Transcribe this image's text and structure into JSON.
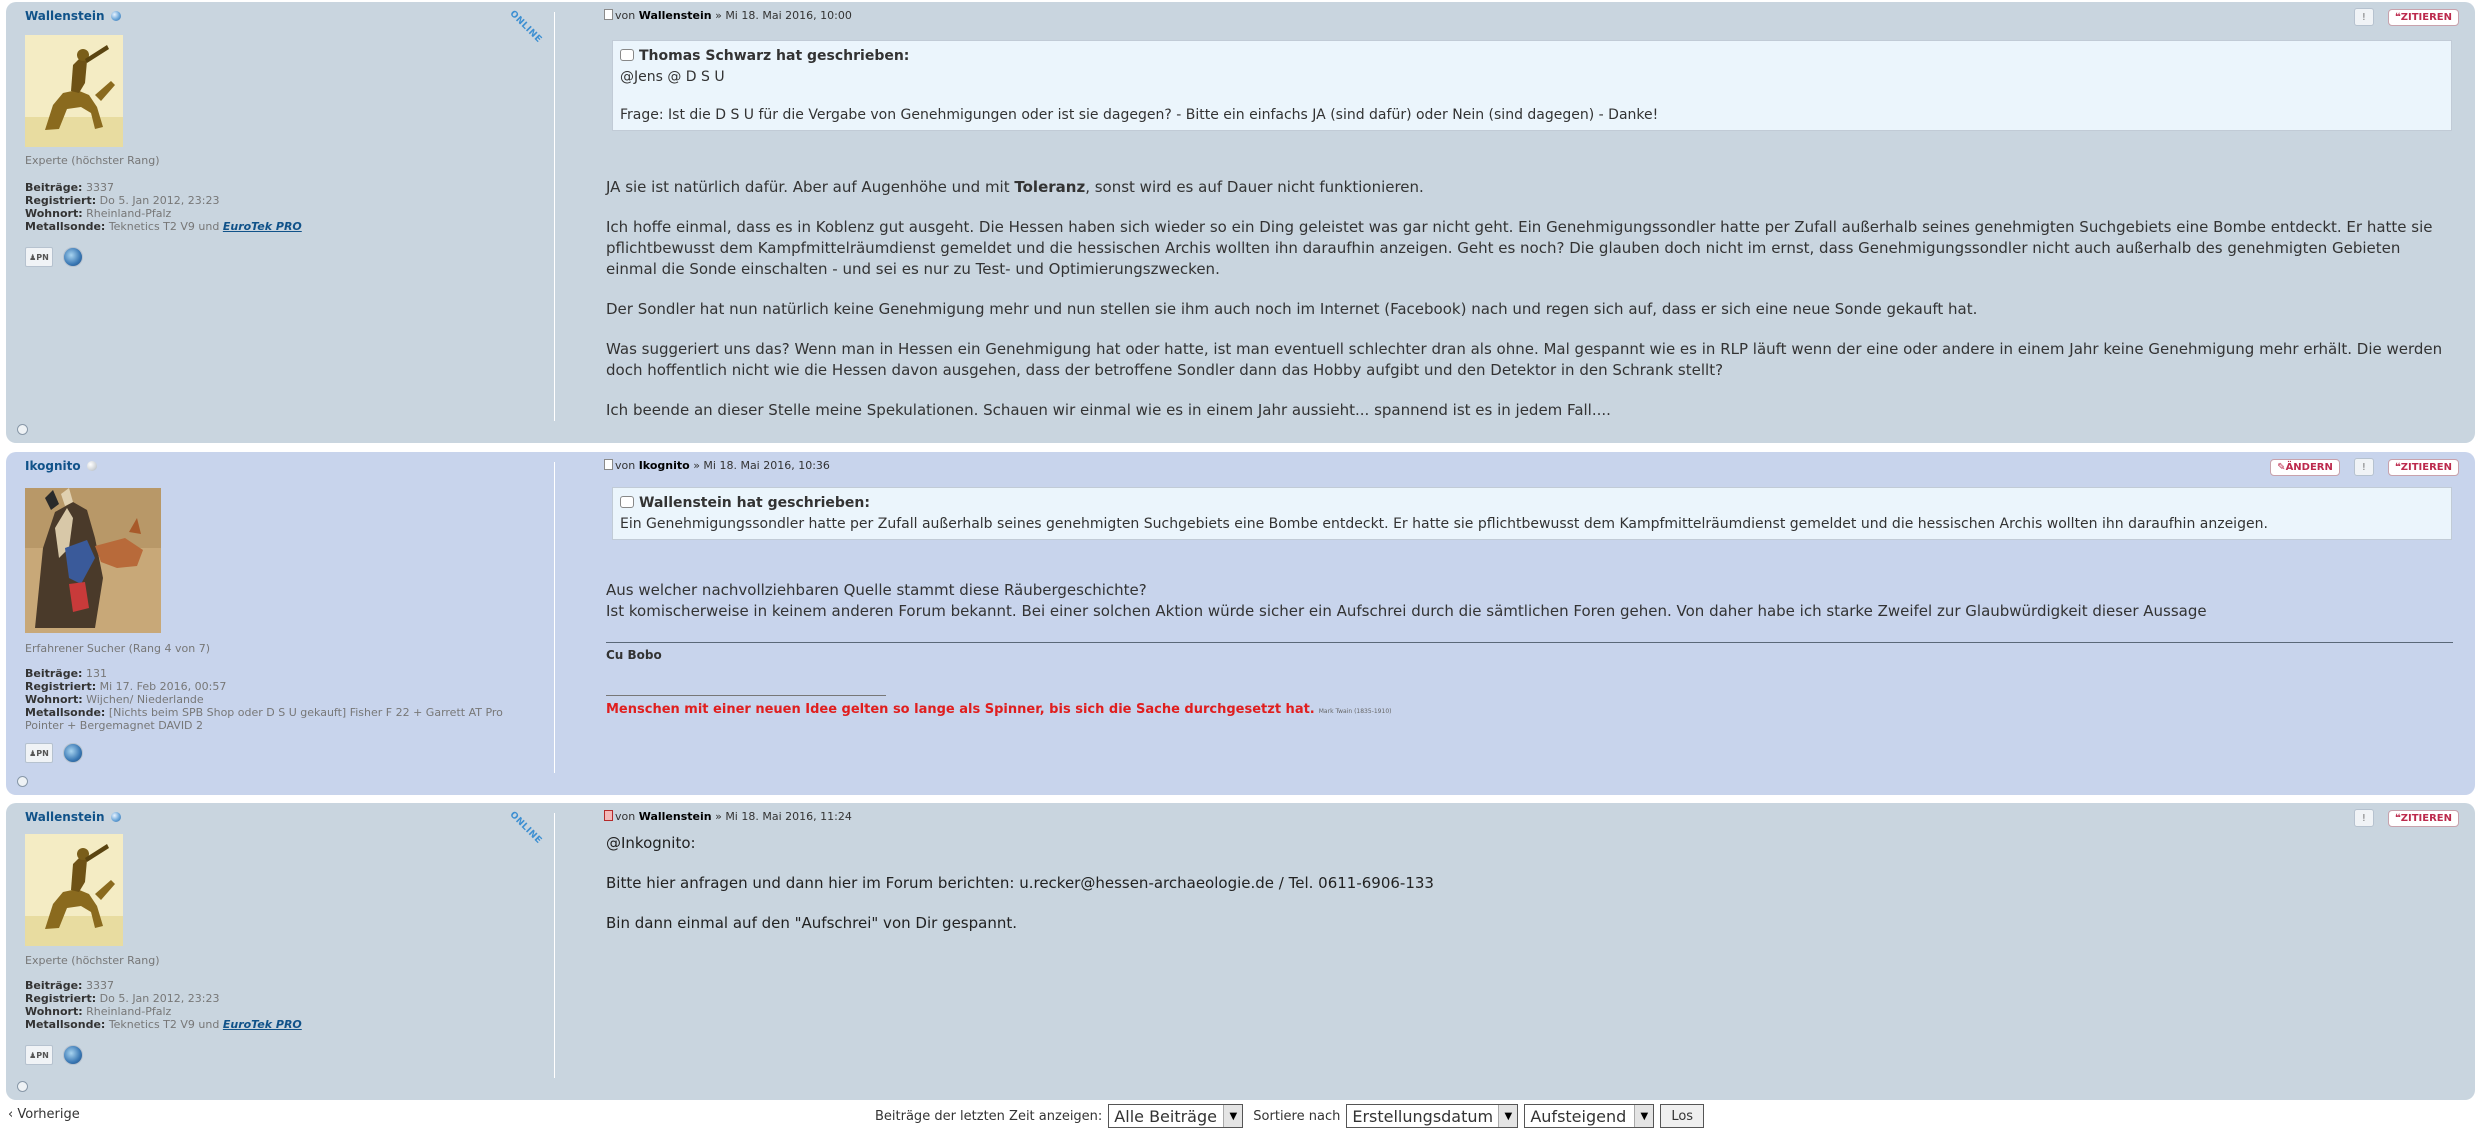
{
  "posts": [
    {
      "username": "Wallenstein",
      "online_badge": "ONLINE",
      "rank": "Experte (höchster Rang)",
      "posts_label": "Beiträge:",
      "posts_value": "3337",
      "registered_label": "Registriert:",
      "registered_value": "Do 5. Jan 2012, 23:23",
      "location_label": "Wohnort:",
      "location_value": "Rheinland-Pfalz",
      "detector_label": "Metallsonde:",
      "detector_value": "Teknetics T2 V9 und",
      "detector_link": "EuroTek PRO",
      "pm_label": "PN",
      "author_prefix": "von",
      "author": "Wallenstein",
      "date": "» Mi 18. Mai 2016, 10:00",
      "quote_button": "ZITIEREN",
      "quote": {
        "header": "Thomas Schwarz hat geschrieben:",
        "lines": [
          "@Jens @ D S U",
          "",
          "Frage: Ist die D S U für die Vergabe von Genehmigungen oder ist sie dagegen? - Bitte ein einfachs JA (sind dafür) oder Nein (sind dagegen) - Danke!"
        ]
      },
      "body_1_before": "JA sie ist natürlich dafür. Aber auf Augenhöhe und mit ",
      "body_1_bold": "Toleranz",
      "body_1_after": ", sonst wird es auf Dauer nicht funktionieren.",
      "body_2": "Ich hoffe einmal, dass es in Koblenz gut ausgeht. Die Hessen haben sich wieder so ein Ding geleistet was gar nicht geht. Ein Genehmigungssondler hatte per Zufall außerhalb seines genehmigten Suchgebiets eine Bombe entdeckt. Er hatte sie pflichtbewusst dem Kampfmittelräumdienst gemeldet und die hessischen Archis wollten ihn daraufhin anzeigen. Geht es noch? Die glauben doch nicht im ernst, dass Genehmigungssondler nicht auch außerhalb des genehmigten Gebieten einmal die Sonde einschalten - und sei es nur zu Test- und Optimierungszwecken.",
      "body_3": "Der Sondler hat nun natürlich keine Genehmigung mehr und nun stellen sie ihm auch noch im Internet (Facebook) nach und regen sich auf, dass er sich eine neue Sonde gekauft hat.",
      "body_4": "Was suggeriert uns das? Wenn man in Hessen ein Genehmigung hat oder hatte, ist man eventuell schlechter dran als ohne. Mal gespannt wie es in RLP läuft wenn der eine oder andere in einem Jahr keine Genehmigung mehr erhält. Die werden doch hoffentlich nicht wie die Hessen davon ausgehen, dass der betroffene Sondler dann das Hobby aufgibt und den Detektor in den Schrank stellt?",
      "body_5": "Ich beende an dieser Stelle meine Spekulationen. Schauen wir einmal wie es in einem Jahr aussieht... spannend ist es in jedem Fall...."
    },
    {
      "username": "Ikognito",
      "rank": "Erfahrener Sucher (Rang 4 von 7)",
      "posts_label": "Beiträge:",
      "posts_value": "131",
      "registered_label": "Registriert:",
      "registered_value": "Mi 17. Feb 2016, 00:57",
      "location_label": "Wohnort:",
      "location_value": "Wijchen/ Niederlande",
      "detector_label": "Metallsonde:",
      "detector_value": "[Nichts beim SPB Shop oder D S U gekauft] Fisher F 22 + Garrett AT Pro Pointer + Bergemagnet DAVID 2",
      "pm_label": "PN",
      "author_prefix": "von",
      "author": "Ikognito",
      "date": "» Mi 18. Mai 2016, 10:36",
      "edit_button": "ÄNDERN",
      "quote_button": "ZITIEREN",
      "quote": {
        "header": "Wallenstein hat geschrieben:",
        "lines": [
          "Ein Genehmigungssondler hatte per Zufall außerhalb seines genehmigten Suchgebiets eine Bombe entdeckt. Er hatte sie pflichtbewusst dem Kampfmittelräumdienst gemeldet und die hessischen Archis wollten ihn daraufhin anzeigen."
        ]
      },
      "body_1": "Aus welcher nachvollziehbaren Quelle stammt diese Räubergeschichte?",
      "body_2": "Ist komischerweise in keinem anderen Forum bekannt. Bei einer solchen Aktion würde sicher ein Aufschrei durch die sämtlichen Foren gehen. Von daher habe ich starke Zweifel zur Glaubwürdigkeit dieser Aussage",
      "signature_name": "Cu Bobo",
      "signature_quote": "Menschen mit einer neuen Idee gelten so lange als Spinner, bis sich die Sache durchgesetzt hat.",
      "signature_small": "Mark Twain (1835-1910)"
    },
    {
      "username": "Wallenstein",
      "online_badge": "ONLINE",
      "rank": "Experte (höchster Rang)",
      "posts_label": "Beiträge:",
      "posts_value": "3337",
      "registered_label": "Registriert:",
      "registered_value": "Do 5. Jan 2012, 23:23",
      "location_label": "Wohnort:",
      "location_value": "Rheinland-Pfalz",
      "detector_label": "Metallsonde:",
      "detector_value": "Teknetics T2 V9 und",
      "detector_link": "EuroTek PRO",
      "pm_label": "PN",
      "author_prefix": "von",
      "author": "Wallenstein",
      "date": "» Mi 18. Mai 2016, 11:24",
      "quote_button": "ZITIEREN",
      "body_1": "@Inkognito:",
      "body_2": "Bitte hier anfragen und dann hier im Forum berichten: u.recker@hessen-archaeologie.de / Tel. 0611-6906-133",
      "body_3": "Bin dann einmal auf den \"Aufschrei\" von Dir gespannt."
    }
  ],
  "footer": {
    "prev_link": "‹ Vorherige",
    "display_label": "Beiträge der letzten Zeit anzeigen:",
    "display_value": "Alle Beiträge",
    "sort_label": "Sortiere nach",
    "sort_value": "Erstellungsdatum",
    "order_value": "Aufsteigend",
    "go_button": "Los"
  },
  "colors": {
    "post_bg_1": "#c9d5df",
    "post_bg_2": "#c8d4ec",
    "username": "#105289",
    "quote_button": "#bc2a4d",
    "signature_red": "#e01e1e"
  }
}
